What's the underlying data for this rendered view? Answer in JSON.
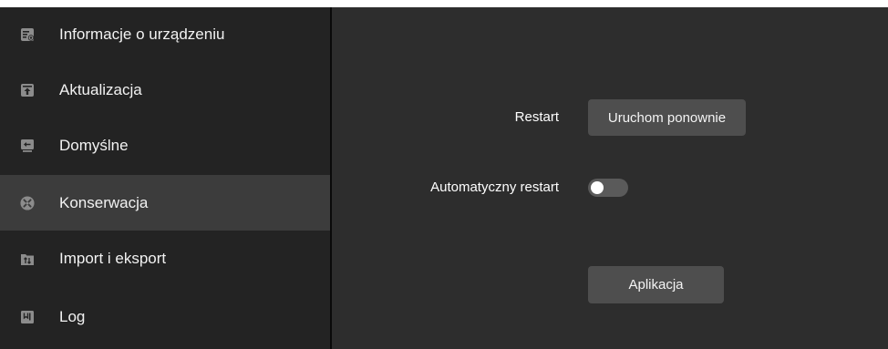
{
  "sidebar": {
    "items": [
      {
        "label": "Informacje o urządzeniu",
        "icon": "device-info-icon",
        "active": false
      },
      {
        "label": "Aktualizacja",
        "icon": "upload-icon",
        "active": false
      },
      {
        "label": "Domyślne",
        "icon": "restore-default-icon",
        "active": false
      },
      {
        "label": "Konserwacja",
        "icon": "tools-icon",
        "active": true
      },
      {
        "label": "Import i eksport",
        "icon": "import-export-icon",
        "active": false
      },
      {
        "label": "Log",
        "icon": "log-icon",
        "active": false
      }
    ]
  },
  "main": {
    "restart_label": "Restart",
    "restart_button": "Uruchom ponownie",
    "auto_restart_label": "Automatyczny restart",
    "auto_restart_enabled": false,
    "apply_button": "Aplikacja"
  },
  "colors": {
    "sidebar_bg": "#232323",
    "sidebar_active_bg": "#3c3c3c",
    "main_bg": "#2d2d2d",
    "button_bg": "#4e4e4e"
  }
}
